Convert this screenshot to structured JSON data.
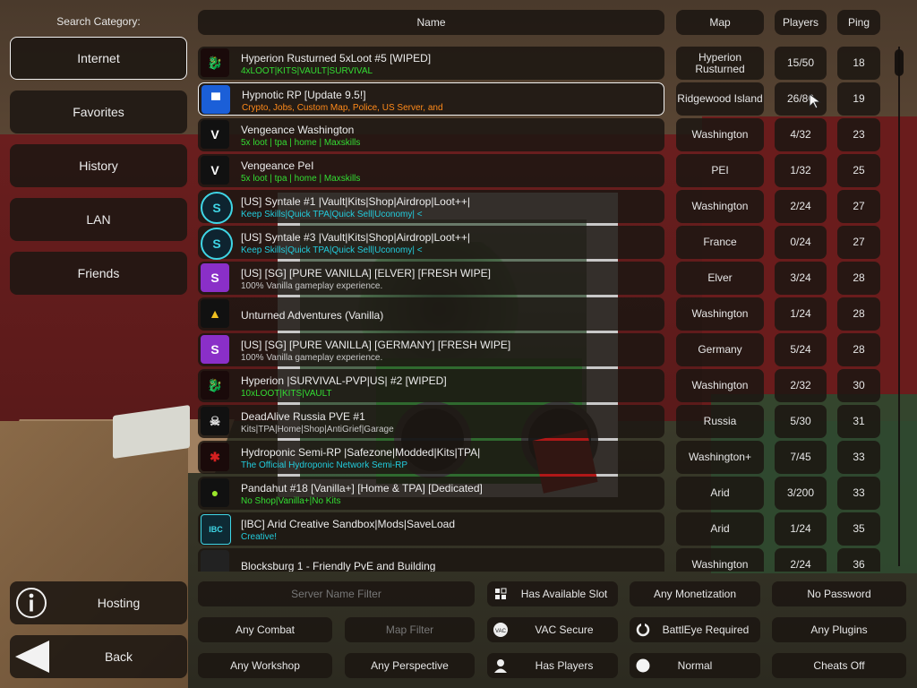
{
  "sidebar": {
    "label": "Search Category:",
    "items": [
      {
        "label": "Internet"
      },
      {
        "label": "Favorites"
      },
      {
        "label": "History"
      },
      {
        "label": "LAN"
      },
      {
        "label": "Friends"
      }
    ],
    "hosting": "Hosting",
    "back": "Back"
  },
  "headers": {
    "name": "Name",
    "map": "Map",
    "players": "Players",
    "ping": "Ping"
  },
  "servers": [
    {
      "title": "Hyperion Rusturned 5xLoot #5 [WIPED]",
      "desc": "4xLOOT|KITS|VAULT|SURVIVAL",
      "desc_color": "#33dd33",
      "map": "Hyperion Rusturned",
      "players": "15/50",
      "ping": "18",
      "icon": "hyperion-dragon-icon",
      "icon_bg": "#1a0a0a",
      "icon_fg": "#d42020",
      "icon_glyph": "🐉"
    },
    {
      "title": "Hypnotic RP [Update 9.5!]",
      "desc": "Crypto, Jobs, Custom Map, Police, US Server, and",
      "desc_color": "#ff8a1a",
      "map": "Ridgewood Island",
      "players": "26/80",
      "ping": "19",
      "icon": "hypnotic-badge-icon",
      "icon_bg": "#1b5fd8",
      "icon_fg": "#ffffff",
      "icon_glyph": "▀"
    },
    {
      "title": "Vengeance Washington",
      "desc": "5x loot | tpa | home | Maxskills",
      "desc_color": "#33dd33",
      "map": "Washington",
      "players": "4/32",
      "ping": "23",
      "icon": "vengeance-v-icon",
      "icon_bg": "#111111",
      "icon_fg": "#ffffff",
      "icon_glyph": "V"
    },
    {
      "title": "Vengeance PeI",
      "desc": "5x loot | tpa | home | Maxskills",
      "desc_color": "#33dd33",
      "map": "PEI",
      "players": "1/32",
      "ping": "25",
      "icon": "vengeance-v-icon",
      "icon_bg": "#111111",
      "icon_fg": "#ffffff",
      "icon_glyph": "V"
    },
    {
      "title": "[US] Syntale #1 |Vault|Kits|Shop|Airdrop|Loot++|",
      "desc": "Keep Skills|Quick TPA|Quick Sell|Uconomy|      <",
      "desc_color": "#22ccdd",
      "map": "Washington",
      "players": "2/24",
      "ping": "27",
      "icon": "syntale-s-icon",
      "icon_bg": "#0e2430",
      "icon_fg": "#3fd6e6",
      "icon_glyph": "S"
    },
    {
      "title": "[US] Syntale #3 |Vault|Kits|Shop|Airdrop|Loot++|",
      "desc": "Keep Skills|Quick TPA|Quick Sell|Uconomy|      <",
      "desc_color": "#22ccdd",
      "map": "France",
      "players": "0/24",
      "ping": "27",
      "icon": "syntale-s-icon",
      "icon_bg": "#0e2430",
      "icon_fg": "#3fd6e6",
      "icon_glyph": "S"
    },
    {
      "title": "[US] [SG] [PURE VANILLA] [ELVER] [FRESH WIPE]",
      "desc": "100% Vanilla gameplay experience.",
      "desc_color": "#c8c8c8",
      "map": "Elver",
      "players": "3/24",
      "ping": "28",
      "icon": "purple-s-icon",
      "icon_bg": "#8a2fc8",
      "icon_fg": "#ffffff",
      "icon_glyph": "S"
    },
    {
      "title": "Unturned Adventures (Vanilla)",
      "desc": "",
      "desc_color": "#c8c8c8",
      "map": "Washington",
      "players": "1/24",
      "ping": "28",
      "icon": "adventures-triangle-icon",
      "icon_bg": "#111111",
      "icon_fg": "#f0c020",
      "icon_glyph": "▲"
    },
    {
      "title": "[US] [SG] [PURE VANILLA] [GERMANY] [FRESH WIPE]",
      "desc": "100% Vanilla gameplay experience.",
      "desc_color": "#c8c8c8",
      "map": "Germany",
      "players": "5/24",
      "ping": "28",
      "icon": "purple-s-icon",
      "icon_bg": "#8a2fc8",
      "icon_fg": "#ffffff",
      "icon_glyph": "S"
    },
    {
      "title": "Hyperion |SURVIVAL-PVP|US| #2 [WIPED]",
      "desc": "10xLOOT|KITS|VAULT",
      "desc_color": "#33dd33",
      "map": "Washington",
      "players": "2/32",
      "ping": "30",
      "icon": "hyperion-dragon-icon",
      "icon_bg": "#1a0a0a",
      "icon_fg": "#d42020",
      "icon_glyph": "🐉"
    },
    {
      "title": "DeadAlive Russia PVE #1",
      "desc": "Kits|TPA|Home|Shop|AntiGrief|Garage",
      "desc_color": "#c8c8c8",
      "map": "Russia",
      "players": "5/30",
      "ping": "31",
      "icon": "deadalive-skull-icon",
      "icon_bg": "#111111",
      "icon_fg": "#dddddd",
      "icon_glyph": "☠"
    },
    {
      "title": "Hydroponic Semi-RP |Safezone|Modded|Kits|TPA|",
      "desc": "The Official Hydroponic Network Semi-RP",
      "desc_color": "#22ccdd",
      "map": "Washington+",
      "players": "7/45",
      "ping": "33",
      "icon": "hydroponic-leaf-icon",
      "icon_bg": "#1a0a0a",
      "icon_fg": "#d42020",
      "icon_glyph": "✱"
    },
    {
      "title": "Pandahut #18 [Vanilla+] [Home & TPA] [Dedicated]",
      "desc": "No Shop|Vanilla+|No Kits",
      "desc_color": "#33dd33",
      "map": "Arid",
      "players": "3/200",
      "ping": "33",
      "icon": "pandahut-panda-icon",
      "icon_bg": "#111111",
      "icon_fg": "#9ae62a",
      "icon_glyph": "●"
    },
    {
      "title": "[IBC] Arid Creative Sandbox|Mods|SaveLoad",
      "desc": "Creative!",
      "desc_color": "#22ccdd",
      "map": "Arid",
      "players": "1/24",
      "ping": "35",
      "icon": "ibc-logo-icon",
      "icon_bg": "#0e2a34",
      "icon_fg": "#3fd6e6",
      "icon_glyph": "IBC"
    },
    {
      "title": "Blocksburg 1 - Friendly PvE and Building",
      "desc": "",
      "desc_color": "#c8c8c8",
      "map": "Washington",
      "players": "2/24",
      "ping": "36",
      "icon": "blocksburg-icon",
      "icon_bg": "#222222",
      "icon_fg": "#dddddd",
      "icon_glyph": ""
    }
  ],
  "filters": {
    "server_name_placeholder": "Server Name Filter",
    "map_placeholder": "Map Filter",
    "has_available_slot": "Has Available Slot",
    "monetization": "Any Monetization",
    "password": "No Password",
    "combat": "Any Combat",
    "vac": "VAC Secure",
    "battleye": "BattlEye Required",
    "plugins": "Any Plugins",
    "workshop": "Any Workshop",
    "perspective": "Any Perspective",
    "has_players": "Has Players",
    "mode": "Normal",
    "cheats": "Cheats Off"
  }
}
